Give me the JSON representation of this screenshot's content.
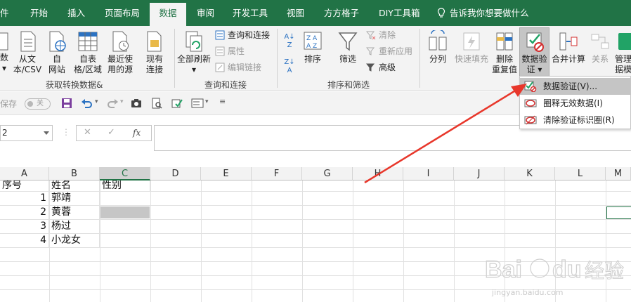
{
  "tabs": [
    {
      "label": "件"
    },
    {
      "label": "开始"
    },
    {
      "label": "插入"
    },
    {
      "label": "页面布局"
    },
    {
      "label": "数据"
    },
    {
      "label": "审阅"
    },
    {
      "label": "开发工具"
    },
    {
      "label": "视图"
    },
    {
      "label": "方方格子"
    },
    {
      "label": "DIY工具箱"
    }
  ],
  "tell_me": "告诉我你想要做什么",
  "ribbon": {
    "get_data": {
      "from_db_line1": "数",
      "from_text_line1": "从文",
      "from_text_line2": "本/CSV",
      "from_web_line1": "自",
      "from_web_line2": "网站",
      "from_table_line1": "自表",
      "from_table_line2": "格/区域",
      "recent_sources_line1": "最近使",
      "recent_sources_line2": "用的源",
      "existing_conn_line1": "现有",
      "existing_conn_line2": "连接",
      "group_label": "获取转换数据&"
    },
    "queries": {
      "refresh_all": "全部刷新",
      "queries_connections": "查询和连接",
      "properties": "属性",
      "edit_links": "编辑链接",
      "group_label": "查询和连接"
    },
    "sort_filter": {
      "sort_az": "A→Z",
      "sort": "排序",
      "filter": "筛选",
      "clear": "清除",
      "reapply": "重新应用",
      "advanced": "高级",
      "group_label": "排序和筛选"
    },
    "data_tools": {
      "text_to_columns": "分列",
      "flash_fill": "快速填充",
      "remove_dup_line1": "删除",
      "remove_dup_line2": "重复值",
      "validation_line1": "数据验",
      "validation_line2": "证",
      "consolidate": "合并计算",
      "relationships": "关系",
      "manage_line1": "管理",
      "manage_line2": "据模"
    }
  },
  "dropdown": {
    "items": [
      {
        "label": "数据验证(V)..."
      },
      {
        "label": "圈释无效数据(I)"
      },
      {
        "label": "清除验证标识圈(R)"
      }
    ]
  },
  "qat": {
    "autosave_label": "保存",
    "toggle_state": "关"
  },
  "formula_bar": {
    "name_box": "2",
    "cancel": "✕",
    "enter": "✓",
    "fx": "fx",
    "content": ""
  },
  "columns": [
    "A",
    "B",
    "C",
    "D",
    "E",
    "F",
    "G",
    "H",
    "I",
    "J",
    "K",
    "L",
    "M"
  ],
  "table": {
    "headers": {
      "a": "序号",
      "b": "姓名",
      "c": "性别"
    },
    "rows": [
      {
        "seq": "1",
        "name": "郭靖"
      },
      {
        "seq": "2",
        "name": "黄蓉"
      },
      {
        "seq": "3",
        "name": "杨过"
      },
      {
        "seq": "4",
        "name": "小龙女"
      }
    ]
  },
  "watermark": {
    "brand": "Bai du 经验",
    "url": "jingyan.baidu.com"
  },
  "colors": {
    "excel_green": "#217346",
    "arrow_red": "#e8372b",
    "menu_hover": "#c5c5c5"
  }
}
